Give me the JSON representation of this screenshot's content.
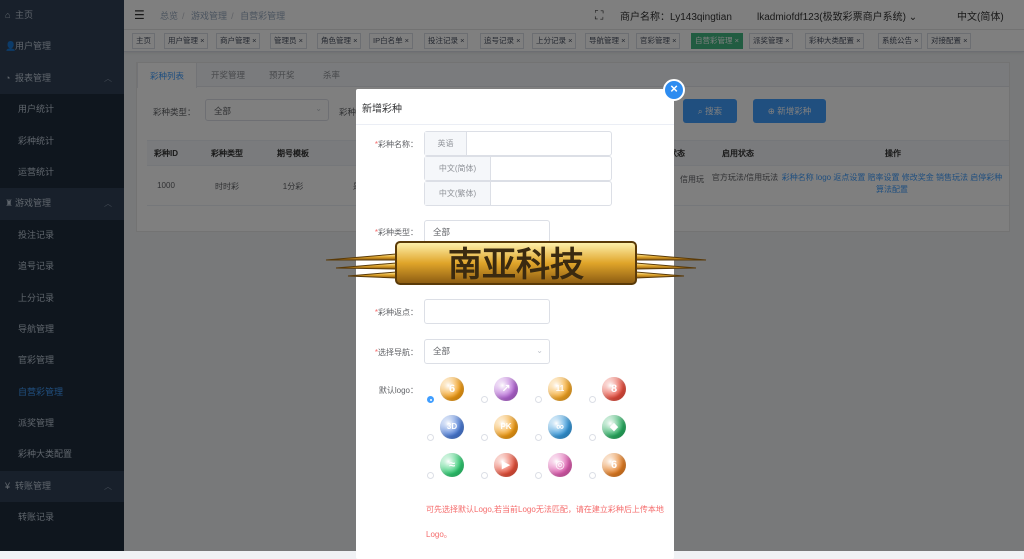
{
  "sidebar": {
    "items": [
      {
        "icon": "home-icon",
        "label": "主页",
        "type": "top"
      },
      {
        "icon": "user-icon",
        "label": "用户管理",
        "type": "top"
      },
      {
        "icon": "pie-chart-icon",
        "label": "报表管理",
        "type": "top",
        "expanded": true
      },
      {
        "label": "用户统计",
        "type": "sub"
      },
      {
        "label": "彩种统计",
        "type": "sub"
      },
      {
        "label": "运营统计",
        "type": "sub"
      },
      {
        "icon": "gamepad-icon",
        "label": "游戏管理",
        "type": "top",
        "expanded": true
      },
      {
        "label": "投注记录",
        "type": "sub"
      },
      {
        "label": "追号记录",
        "type": "sub"
      },
      {
        "label": "上分记录",
        "type": "sub"
      },
      {
        "label": "导航管理",
        "type": "sub"
      },
      {
        "label": "官彩管理",
        "type": "sub"
      },
      {
        "label": "自营彩管理",
        "type": "sub",
        "active": true
      },
      {
        "label": "派奖管理",
        "type": "sub"
      },
      {
        "label": "彩种大类配置",
        "type": "sub"
      },
      {
        "icon": "yen-icon",
        "label": "转账管理",
        "type": "top",
        "expanded": true
      },
      {
        "label": "转账记录",
        "type": "sub"
      }
    ]
  },
  "header": {
    "breadcrumb": [
      "总览",
      "游戏管理",
      "自营彩管理"
    ],
    "merchant": "商户名称：Ly143qingtian",
    "account": "lkadmiofdf123(极致彩票商户系统)",
    "language": "中文(简体)"
  },
  "tags": [
    "主页",
    "用户管理",
    "商户管理",
    "管理员",
    "角色管理",
    "IP白名单",
    "投注记录",
    "追号记录",
    "上分记录",
    "导航管理",
    "官彩管理",
    "自营彩管理",
    "派奖管理",
    "彩种大类配置",
    "系统公告",
    "对接配置"
  ],
  "active_tag": "自营彩管理",
  "tabs": [
    "彩种列表",
    "开奖管理",
    "预开奖",
    "杀率"
  ],
  "filter": {
    "type_label": "彩种类型：",
    "type_value": "全部",
    "name_label": "彩种",
    "search_button": "搜索",
    "add_button": "新增彩种"
  },
  "table": {
    "headers": [
      "彩种ID",
      "彩种类型",
      "期号模板",
      "",
      "",
      "状态",
      "启用状态",
      "操作"
    ],
    "row": {
      "id": "1000",
      "type": "时时彩",
      "template": "1分彩",
      "col4": "是",
      "status_partial": "信用玩",
      "enabled": "官方玩法/信用玩法",
      "ops": "彩种名称 logo 返点设置 赔率设置 修改奖金 销售玩法 启停彩种 算法配置"
    }
  },
  "dialog": {
    "title": "新增彩种",
    "name_label": "彩种名称：",
    "name_prefixes": [
      "英语",
      "中文(简体)",
      "中文(繁体)"
    ],
    "type_label": "彩种类型：",
    "type_value": "全部",
    "rebate_label": "彩种返点：",
    "nav_label": "选择导航：",
    "nav_value": "全部",
    "logo_label": "默认logo：",
    "logos": [
      {
        "text": "6",
        "color": "#f39c12"
      },
      {
        "text": "↗",
        "color": "#b566d6"
      },
      {
        "text": "11",
        "color": "#f5a623"
      },
      {
        "text": "8",
        "color": "#e74c3c"
      },
      {
        "text": "3D",
        "color": "#4a7bd8"
      },
      {
        "text": "PK",
        "color": "#f39c12"
      },
      {
        "text": "∞",
        "color": "#3498db"
      },
      {
        "text": "◆",
        "color": "#27ae60"
      },
      {
        "text": "≈",
        "color": "#2ecc71"
      },
      {
        "text": "▶",
        "color": "#e8503a"
      },
      {
        "text": "◎",
        "color": "#e05cb0"
      },
      {
        "text": "6",
        "color": "#e67e22"
      }
    ],
    "hint": "可先选择默认Logo,若当前Logo无法匹配，请在建立彩种后上传本地Logo。"
  },
  "watermark": "南亚科技"
}
